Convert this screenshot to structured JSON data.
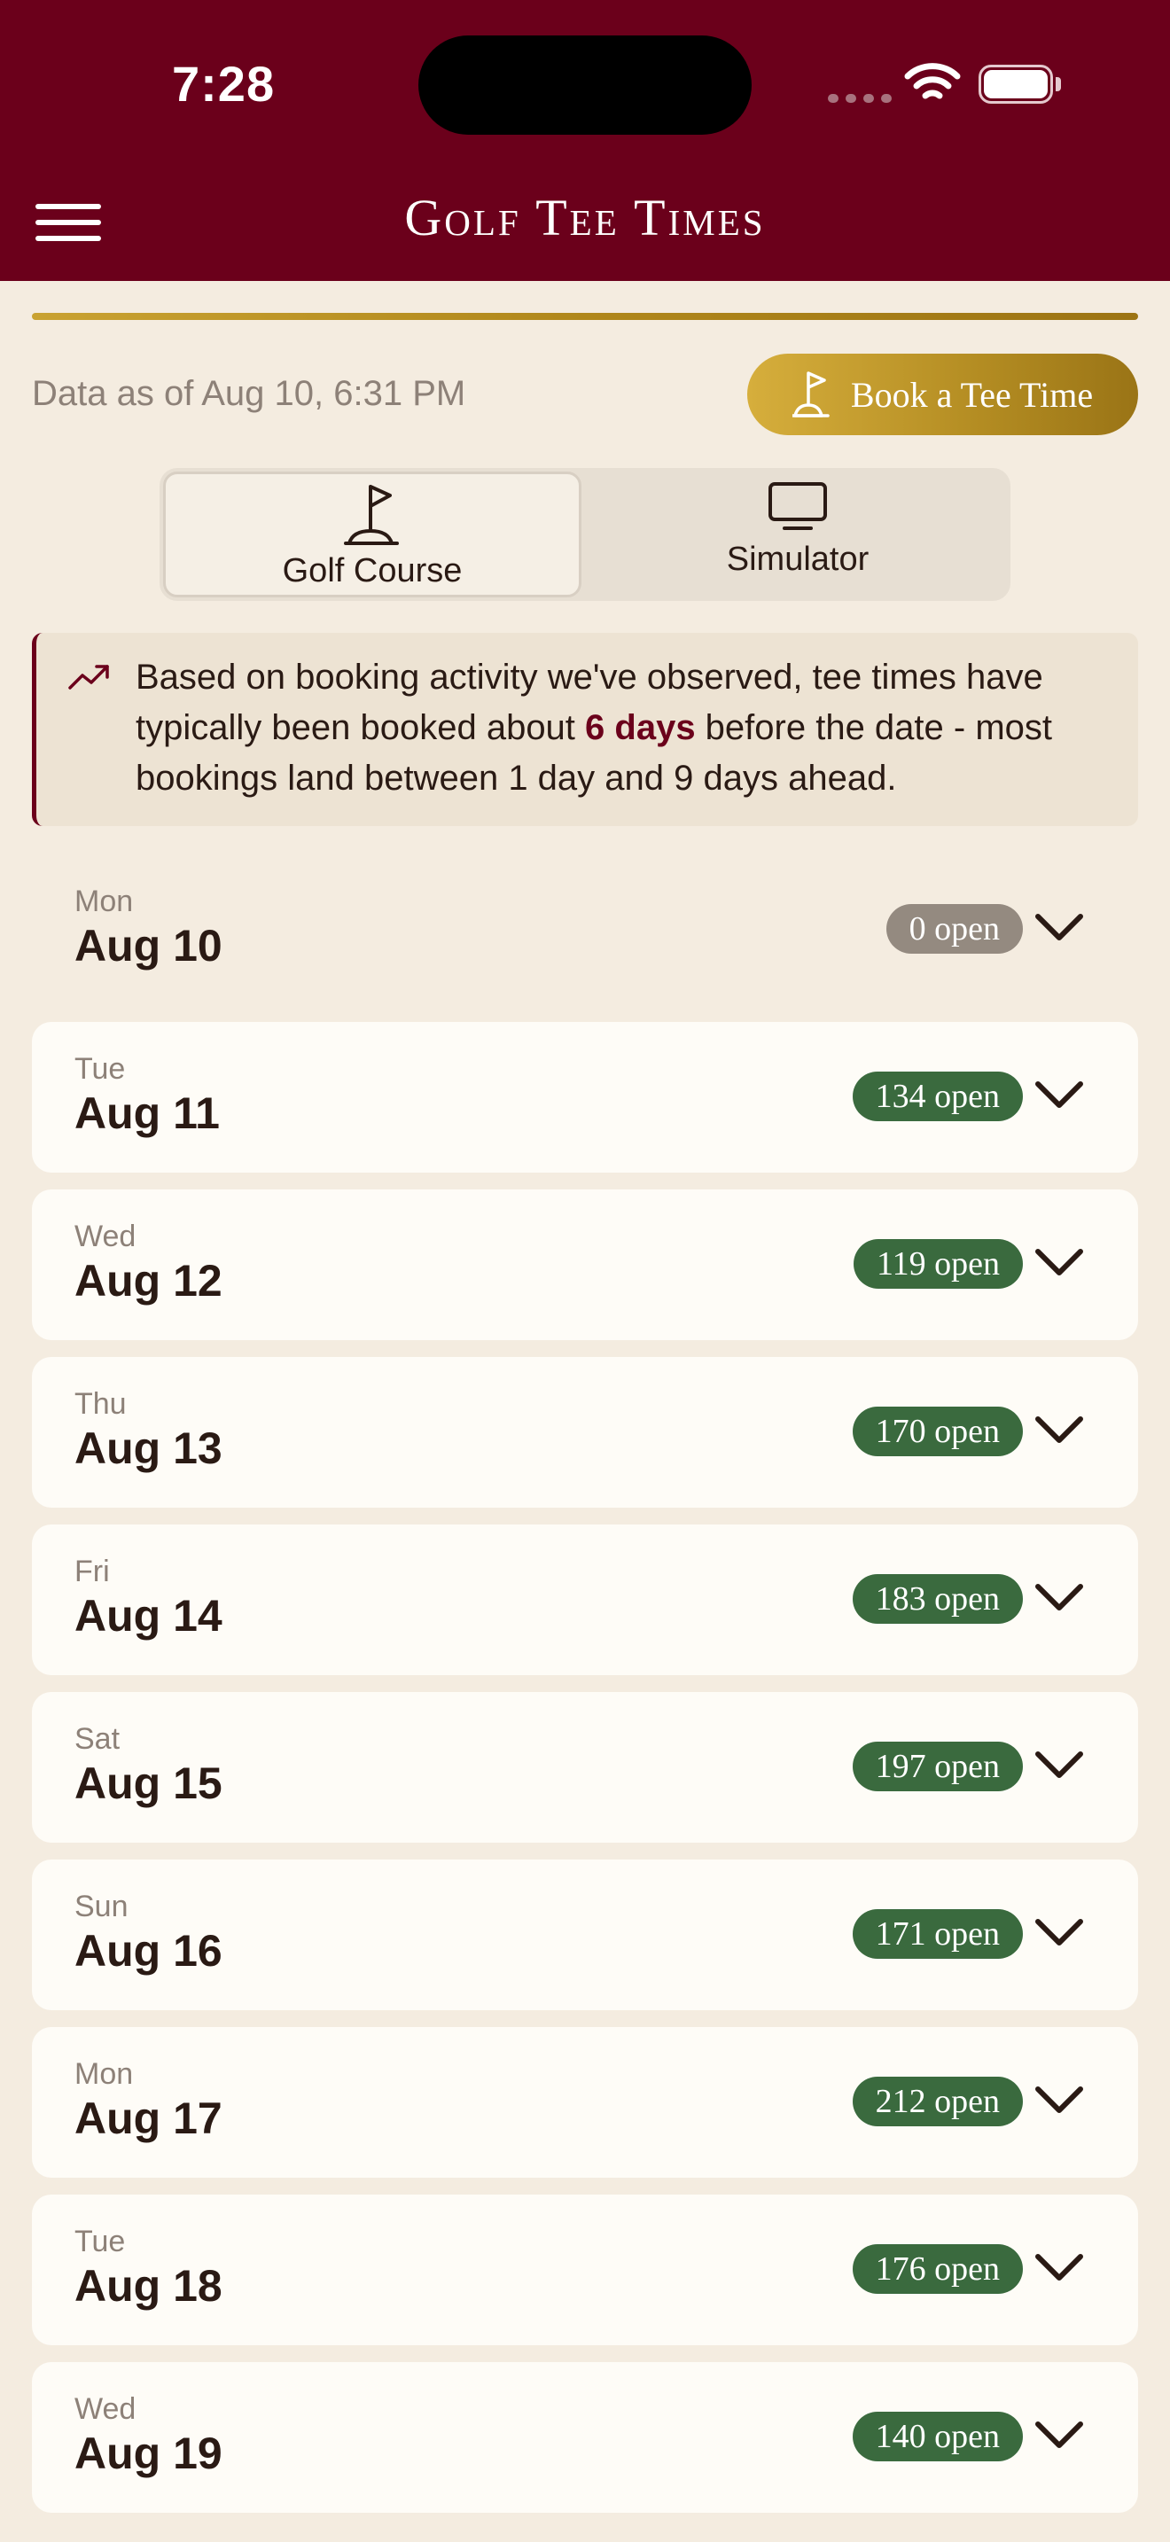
{
  "status_bar": {
    "time": "7:28"
  },
  "header": {
    "title": "Golf Tee Times"
  },
  "info_row": {
    "data_as_of": "Data as of Aug 10, 6:31 PM",
    "book_button": "Book a Tee Time"
  },
  "segments": [
    {
      "label": "Golf Course",
      "icon": "golf-flag-icon",
      "selected": true
    },
    {
      "label": "Simulator",
      "icon": "monitor-icon",
      "selected": false
    }
  ],
  "banner": {
    "icon": "trending-up-icon",
    "text_before": "Based on booking activity we've observed, tee times have typically been booked about ",
    "highlight": "6 days",
    "text_after": " before the date - most bookings land between 1 day and 9 days ahead."
  },
  "days": [
    {
      "dow": "Mon",
      "date": "Aug 10",
      "open": "0 open",
      "status": "none"
    },
    {
      "dow": "Tue",
      "date": "Aug 11",
      "open": "134 open",
      "status": "open"
    },
    {
      "dow": "Wed",
      "date": "Aug 12",
      "open": "119 open",
      "status": "open"
    },
    {
      "dow": "Thu",
      "date": "Aug 13",
      "open": "170 open",
      "status": "open"
    },
    {
      "dow": "Fri",
      "date": "Aug 14",
      "open": "183 open",
      "status": "open"
    },
    {
      "dow": "Sat",
      "date": "Aug 15",
      "open": "197 open",
      "status": "open"
    },
    {
      "dow": "Sun",
      "date": "Aug 16",
      "open": "171 open",
      "status": "open"
    },
    {
      "dow": "Mon",
      "date": "Aug 17",
      "open": "212 open",
      "status": "open"
    },
    {
      "dow": "Tue",
      "date": "Aug 18",
      "open": "176 open",
      "status": "open"
    },
    {
      "dow": "Wed",
      "date": "Aug 19",
      "open": "140 open",
      "status": "open"
    }
  ],
  "colors": {
    "header": "#6b001b",
    "background": "#f4ece0",
    "gold": "#b38c22",
    "open_badge": "#3a6a3e",
    "none_badge": "#948a80"
  }
}
